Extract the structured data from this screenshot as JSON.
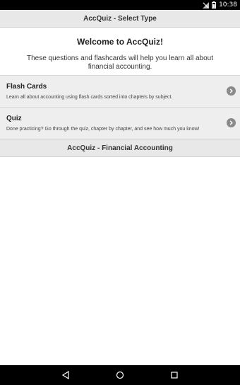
{
  "status_bar": {
    "time": "10:38",
    "icons": [
      "signal-off-icon",
      "battery-icon"
    ]
  },
  "header": {
    "title": "AccQuiz - Select Type"
  },
  "welcome": {
    "heading": "Welcome to AccQuiz!",
    "subtitle": "These questions and flashcards will help you learn all about financial accounting."
  },
  "menu": {
    "items": [
      {
        "title": "Flash Cards",
        "description": "Learn all about accounting using flash cards sorted into chapters by subject.",
        "icon": "chevron-right-circle-icon"
      },
      {
        "title": "Quiz",
        "description": "Done practicing? Go through the quiz, chapter by chapter, and see how much you know!",
        "icon": "chevron-right-circle-icon"
      }
    ]
  },
  "footer": {
    "title": "AccQuiz - Financial Accounting"
  },
  "nav_bar": {
    "icons": [
      "back-icon",
      "home-icon",
      "recents-icon"
    ]
  }
}
